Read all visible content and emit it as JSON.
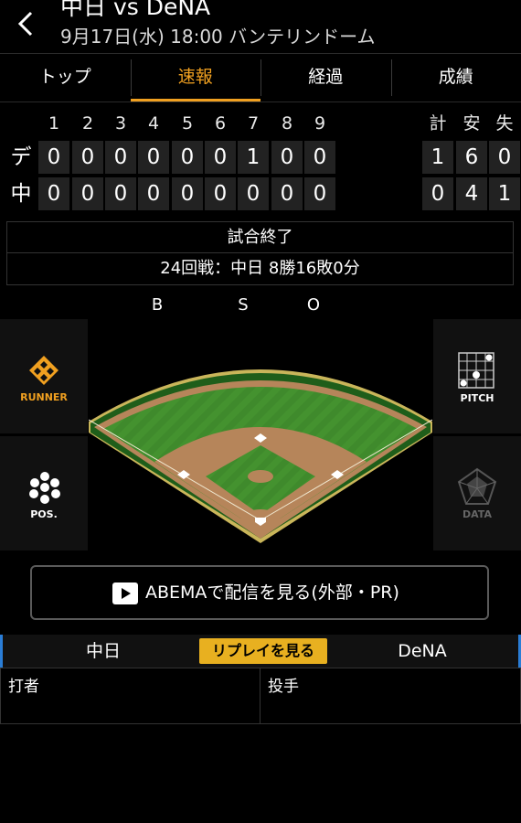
{
  "header": {
    "back_icon": "chevron-left-icon",
    "title": "中日 vs DeNA",
    "subtitle": "9月17日(水) 18:00 バンテリンドーム"
  },
  "tabs": [
    {
      "label": "トップ",
      "active": false
    },
    {
      "label": "速報",
      "active": true
    },
    {
      "label": "経過",
      "active": false
    },
    {
      "label": "成績",
      "active": false
    }
  ],
  "scoreboard": {
    "innings": [
      "1",
      "2",
      "3",
      "4",
      "5",
      "6",
      "7",
      "8",
      "9"
    ],
    "totals_headers": [
      "計",
      "安",
      "失"
    ],
    "rows": [
      {
        "team": "デ",
        "innings": [
          "0",
          "0",
          "0",
          "0",
          "0",
          "0",
          "1",
          "0",
          "0"
        ],
        "totals": [
          "1",
          "6",
          "0"
        ]
      },
      {
        "team": "中",
        "innings": [
          "0",
          "0",
          "0",
          "0",
          "0",
          "0",
          "0",
          "0",
          "0"
        ],
        "totals": [
          "0",
          "4",
          "1"
        ]
      }
    ]
  },
  "status": {
    "state": "試合終了",
    "series": "24回戦：中日 8勝16敗0分"
  },
  "count": {
    "b": "B",
    "s": "S",
    "o": "O"
  },
  "panels": {
    "runner": "RUNNER",
    "pos": "POS.",
    "pitch": "PITCH",
    "data": "DATA"
  },
  "abema": {
    "label": "ABEMAで配信を見る(外部・PR)",
    "icon": "play-icon"
  },
  "replay": {
    "left_team": "中日",
    "button": "リプレイを見る",
    "right_team": "DeNA"
  },
  "players": {
    "batter": "打者",
    "pitcher": "投手"
  },
  "colors": {
    "accent": "#f0a020",
    "replay_button": "#e8b020",
    "blue_border": "#2a7dd6"
  }
}
